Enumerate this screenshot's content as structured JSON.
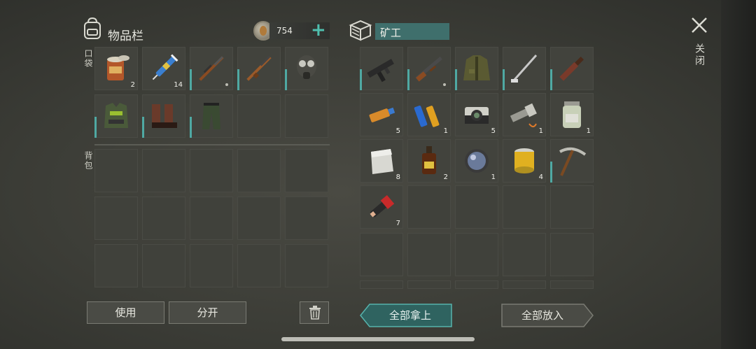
{
  "inventory": {
    "title": "物品栏",
    "currency": "754",
    "pocket_label": "口袋",
    "backpack_label": "背包",
    "pocket_slots": [
      {
        "icon": "canned-food-icon",
        "count": "2"
      },
      {
        "icon": "syringe-icon",
        "count": "14"
      },
      {
        "icon": "hunting-rifle-icon",
        "count": ""
      },
      {
        "icon": "rifle-icon",
        "count": ""
      },
      {
        "icon": "gas-mask-icon",
        "count": ""
      },
      {
        "icon": "vest-armor-icon",
        "count": ""
      },
      {
        "icon": "boots-icon",
        "count": ""
      },
      {
        "icon": "pants-icon",
        "count": ""
      }
    ]
  },
  "container": {
    "name": "矿工",
    "slots": [
      {
        "icon": "smg-icon",
        "count": ""
      },
      {
        "icon": "shotgun-icon",
        "count": ""
      },
      {
        "icon": "jacket-icon",
        "count": ""
      },
      {
        "icon": "golf-club-icon",
        "count": ""
      },
      {
        "icon": "machete-icon",
        "count": ""
      },
      {
        "icon": "usb-drive-icon",
        "count": "5"
      },
      {
        "icon": "batteries-icon",
        "count": "1"
      },
      {
        "icon": "camera-icon",
        "count": "5"
      },
      {
        "icon": "flashlight-icon",
        "count": "1"
      },
      {
        "icon": "pill-bottle-icon",
        "count": "1"
      },
      {
        "icon": "metal-plate-icon",
        "count": "8"
      },
      {
        "icon": "bottle-icon",
        "count": "2"
      },
      {
        "icon": "lens-icon",
        "count": "1"
      },
      {
        "icon": "air-filter-icon",
        "count": "4"
      },
      {
        "icon": "pickaxe-icon",
        "count": ""
      },
      {
        "icon": "flare-icon",
        "count": "7"
      }
    ]
  },
  "buttons": {
    "use": "使用",
    "split": "分开",
    "take_all": "全部拿上",
    "put_all": "全部放入"
  },
  "close_label": "关闭",
  "colors": {
    "accent": "#4fa9a3",
    "name_box": "#3f6f6c"
  }
}
